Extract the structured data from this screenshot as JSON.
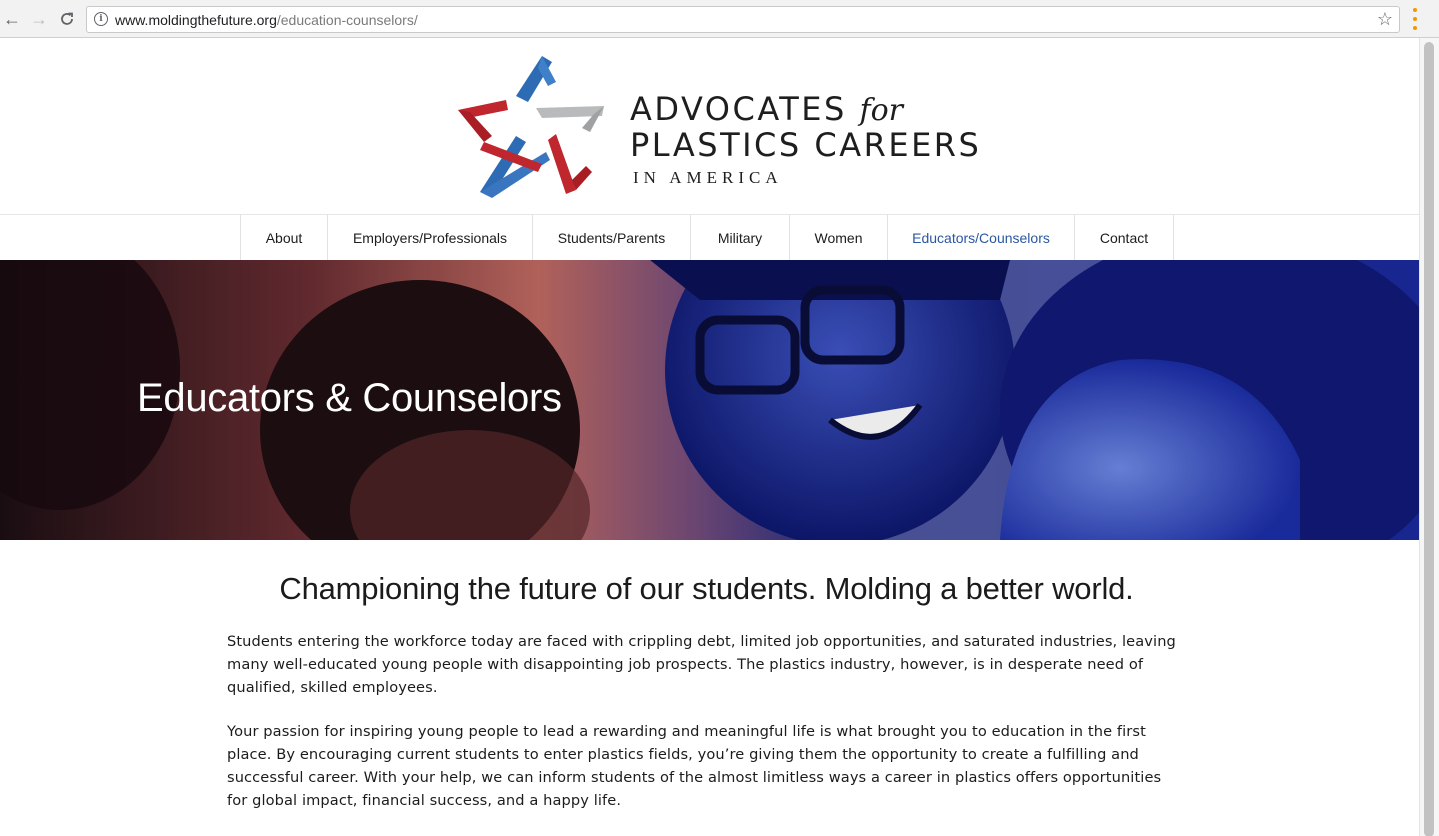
{
  "browser": {
    "url_domain": "www.moldingthefuture.org",
    "url_path": "/education-counselors/",
    "back_icon": "arrow-left-icon",
    "forward_icon": "arrow-right-icon",
    "reload_icon": "reload-icon",
    "bookmark_icon": "star-icon",
    "menu_icon": "vertical-dots-icon"
  },
  "logo": {
    "line1_main": "ADVOCATES",
    "line1_for": "for",
    "line2": "PLASTICS CAREERS",
    "line3": "IN AMERICA",
    "colors": {
      "red": "#c0262d",
      "blue": "#2e6bb5",
      "grey": "#b9babc"
    }
  },
  "nav": {
    "items": [
      {
        "label": "About",
        "active": false
      },
      {
        "label": "Employers/Professionals",
        "active": false
      },
      {
        "label": "Students/Parents",
        "active": false
      },
      {
        "label": "Military",
        "active": false
      },
      {
        "label": "Women",
        "active": false
      },
      {
        "label": "Educators/Counselors",
        "active": true
      },
      {
        "label": "Contact",
        "active": false
      }
    ],
    "active_color": "#2a57a3"
  },
  "hero": {
    "title": "Educators & Counselors"
  },
  "main": {
    "headline": "Championing the future of our students. Molding a better world.",
    "paragraphs": [
      "Students entering the workforce today are faced with crippling debt, limited job opportunities, and saturated industries, leaving many well-educated young people with disappointing job prospects. The plastics industry, however, is in desperate need of qualified, skilled employees.",
      "Your passion for inspiring young people to lead a rewarding and meaningful life is what brought you to education in the first place. By encouraging current students to enter plastics fields, you’re giving them the opportunity to create a fulfilling and successful career. With your help, we can inform students of the almost limitless ways a career in plastics offers opportunities for global impact, financial success, and a happy life."
    ]
  }
}
